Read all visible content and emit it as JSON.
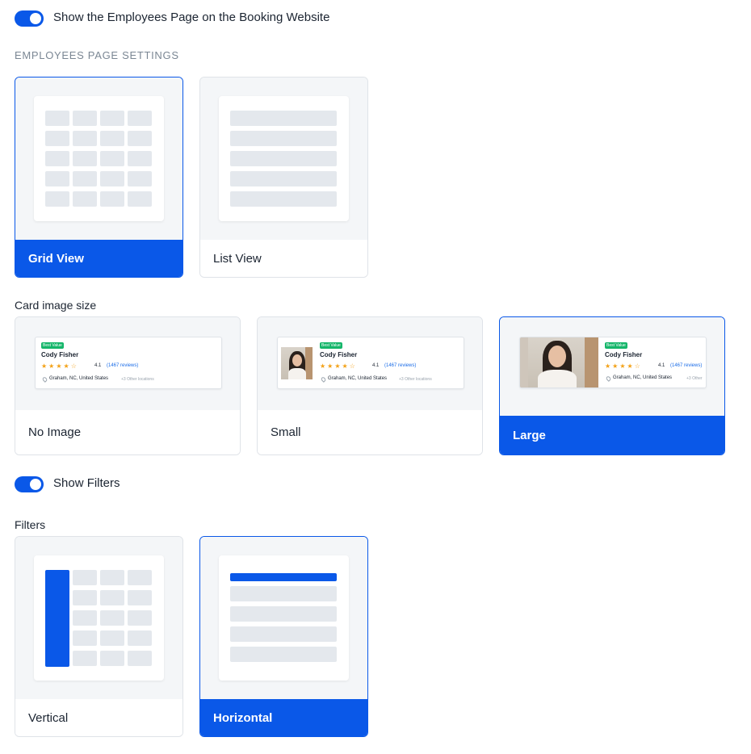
{
  "employees_toggle": {
    "label": "Show the Employees Page on the Booking Website",
    "on": true
  },
  "section_heading": "EMPLOYEES PAGE SETTINGS",
  "view_options": [
    {
      "label": "Grid View",
      "selected": true
    },
    {
      "label": "List View",
      "selected": false
    }
  ],
  "card_image_size": {
    "label": "Card image size",
    "options": [
      {
        "label": "No Image",
        "selected": false
      },
      {
        "label": "Small",
        "selected": false
      },
      {
        "label": "Large",
        "selected": true
      }
    ]
  },
  "employee_card": {
    "badge": "Best Value",
    "name": "Cody Fisher",
    "rating": "4.1",
    "reviews": "(1467 reviews)",
    "location": "Graham, NC, United States",
    "other_locations": "+3 Other locations",
    "other_locations_short": "+3 Other"
  },
  "filters_toggle": {
    "label": "Show Filters",
    "on": true
  },
  "filters": {
    "label": "Filters",
    "options": [
      {
        "label": "Vertical",
        "selected": false
      },
      {
        "label": "Horizontal",
        "selected": true
      }
    ]
  },
  "colors": {
    "accent": "#0a58e8",
    "badge": "#15b66a",
    "star": "#f3a116",
    "placeholder": "#e4e8ed",
    "preview_bg": "#f4f6f8"
  }
}
